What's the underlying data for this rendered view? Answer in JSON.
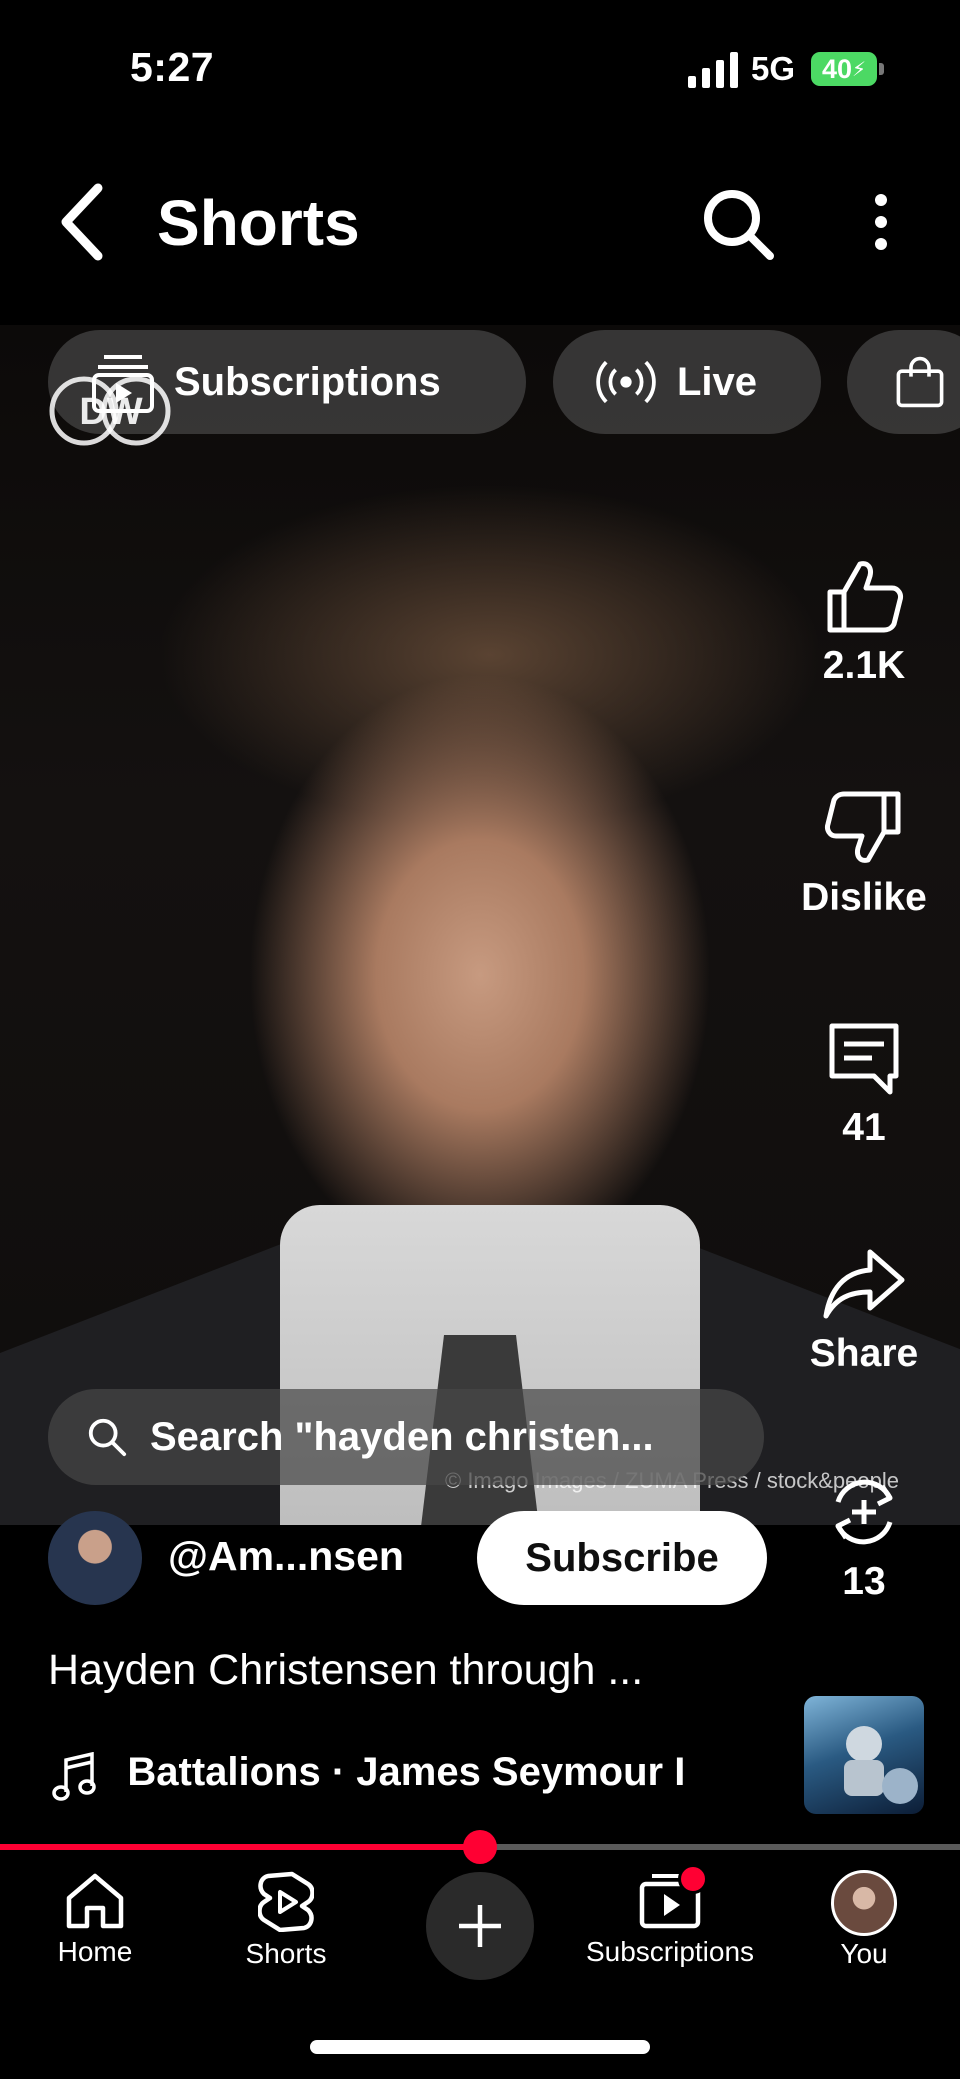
{
  "status_bar": {
    "time": "5:27",
    "network": "5G",
    "battery": "40"
  },
  "header": {
    "title": "Shorts"
  },
  "chips": [
    {
      "label": "Subscriptions"
    },
    {
      "label": "Live"
    }
  ],
  "overlay_logo": "DW",
  "video": {
    "credit": "© Imago Images / ZUMA Press / stock&people"
  },
  "actions": {
    "like_count": "2.1K",
    "dislike_label": "Dislike",
    "comment_count": "41",
    "share_label": "Share",
    "remix_count": "13"
  },
  "search_suggestion": "Search \"hayden christen...",
  "channel": {
    "handle": "@Am...nsen",
    "subscribe_label": "Subscribe"
  },
  "video_title": "Hayden Christensen through ...",
  "music": {
    "text": "e Battalions · James Seymour I"
  },
  "playback": {
    "progress": 0.5
  },
  "nav": {
    "home": "Home",
    "shorts": "Shorts",
    "subscriptions": "Subscriptions",
    "you": "You"
  },
  "colors": {
    "accent": "#ff0033",
    "battery": "#4cd964"
  }
}
